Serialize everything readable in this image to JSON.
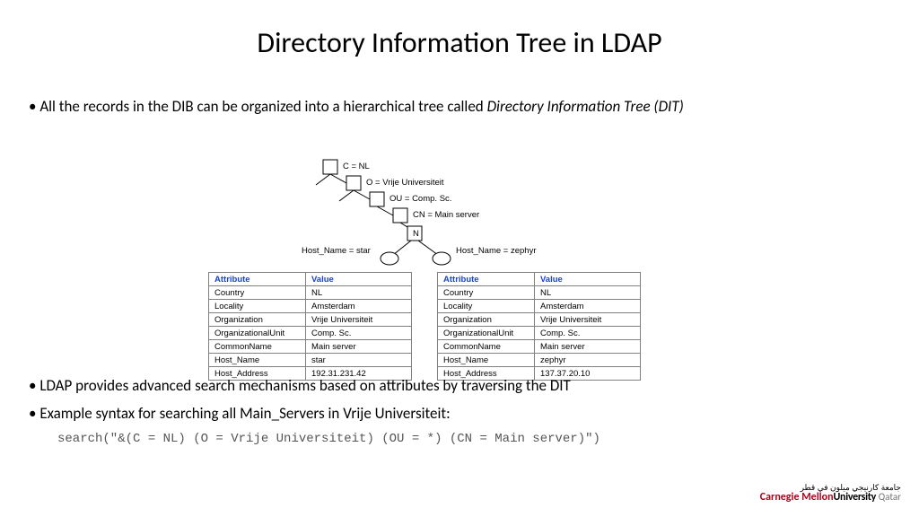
{
  "title": "Directory Information Tree in LDAP",
  "bullet1_lead": "All the records in the DIB can be organized into a hierarchical tree called ",
  "bullet1_em": "Directory Information Tree (DIT)",
  "tree": {
    "c": "C = NL",
    "o": "O = Vrije Universiteit",
    "ou": "OU = Comp. Sc.",
    "cn": "CN = Main server",
    "n": "N",
    "host_l": "Host_Name = star",
    "host_r": "Host_Name = zephyr"
  },
  "headers": {
    "a": "Attribute",
    "v": "Value"
  },
  "left_rows": [
    {
      "a": "Country",
      "v": "NL"
    },
    {
      "a": "Locality",
      "v": "Amsterdam"
    },
    {
      "a": "Organization",
      "v": "Vrije Universiteit"
    },
    {
      "a": "OrganizationalUnit",
      "v": "Comp. Sc."
    },
    {
      "a": "CommonName",
      "v": "Main server"
    },
    {
      "a": "Host_Name",
      "v": "star"
    },
    {
      "a": "Host_Address",
      "v": "192.31.231.42"
    }
  ],
  "right_rows": [
    {
      "a": "Country",
      "v": "NL"
    },
    {
      "a": "Locality",
      "v": "Amsterdam"
    },
    {
      "a": "Organization",
      "v": "Vrije Universiteit"
    },
    {
      "a": "OrganizationalUnit",
      "v": "Comp. Sc."
    },
    {
      "a": "CommonName",
      "v": "Main server"
    },
    {
      "a": "Host_Name",
      "v": "zephyr"
    },
    {
      "a": "Host_Address",
      "v": "137.37.20.10"
    }
  ],
  "bullet2": "LDAP provides advanced search mechanisms based on attributes by traversing the DIT",
  "bullet3": "Example syntax for searching all Main_Servers in Vrije Universiteit:",
  "code": "search(\"&(C = NL) (O = Vrije Universiteit) (OU = *) (CN = Main server)\")",
  "logo": {
    "ar": "جامعة كارنيجي ميلون في قطر",
    "cm": "Carnegie Mellon",
    "un": "University",
    "q": "Qatar"
  }
}
